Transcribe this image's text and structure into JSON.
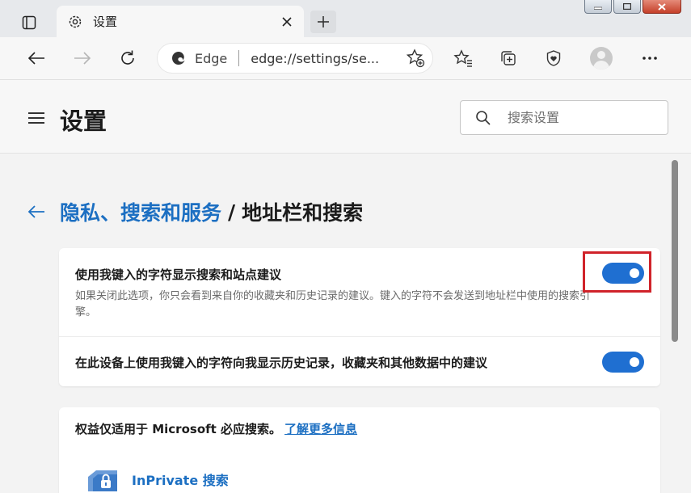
{
  "tab": {
    "title": "设置"
  },
  "toolbar": {
    "site_name": "Edge",
    "url": "edge://settings/se..."
  },
  "header": {
    "title": "设置",
    "search_placeholder": "搜索设置"
  },
  "breadcrumb": {
    "parent": "隐私、搜索和服务",
    "separator": "/",
    "current": "地址栏和搜索"
  },
  "settings": [
    {
      "title": "使用我键入的字符显示搜索和站点建议",
      "description": "如果关闭此选项，你只会看到来自你的收藏夹和历史记录的建议。键入的字符不会发送到地址栏中使用的搜索引擎。",
      "enabled": true
    },
    {
      "title": "在此设备上使用我键入的字符向我显示历史记录，收藏夹和其他数据中的建议",
      "enabled": true
    }
  ],
  "info_card": {
    "text": "权益仅适用于 Microsoft 必应搜索。",
    "link": "了解更多信息",
    "inprivate_label": "InPrivate 搜索"
  },
  "colors": {
    "accent": "#1f6fd1",
    "link": "#1c6fc2",
    "highlight": "#d0232a"
  }
}
